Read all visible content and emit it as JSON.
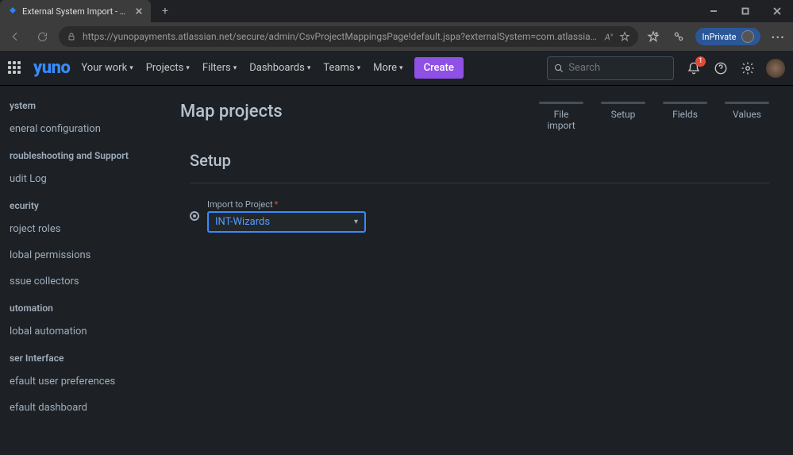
{
  "browser": {
    "tab_title": "External System Import - Jira - Yu",
    "url": "https://yunopayments.atlassian.net/secure/admin/CsvProjectMappingsPage!default.jspa?externalSystem=com.atlassian.jira.plugin...",
    "inprivate_label": "InPrivate"
  },
  "nav": {
    "logo": "yuno",
    "items": [
      "Your work",
      "Projects",
      "Filters",
      "Dashboards",
      "Teams",
      "More"
    ],
    "create": "Create",
    "search_placeholder": "Search",
    "notification_count": "1"
  },
  "sidebar": {
    "sections": [
      {
        "head": "ystem",
        "items": [
          "eneral configuration"
        ]
      },
      {
        "head": "roubleshooting and Support",
        "items": [
          "udit Log"
        ]
      },
      {
        "head": "ecurity",
        "items": [
          "roject roles",
          "lobal permissions",
          "ssue collectors"
        ]
      },
      {
        "head": "utomation",
        "items": [
          "lobal automation"
        ]
      },
      {
        "head": "ser Interface",
        "items": [
          "efault user preferences",
          "efault dashboard"
        ]
      }
    ]
  },
  "main": {
    "title": "Map projects",
    "steps": [
      {
        "label": "File\nimport"
      },
      {
        "label": "Setup"
      },
      {
        "label": "Fields"
      },
      {
        "label": "Values"
      }
    ],
    "subtitle": "Setup",
    "import_label": "Import to Project",
    "select_value": "INT-Wizards"
  }
}
